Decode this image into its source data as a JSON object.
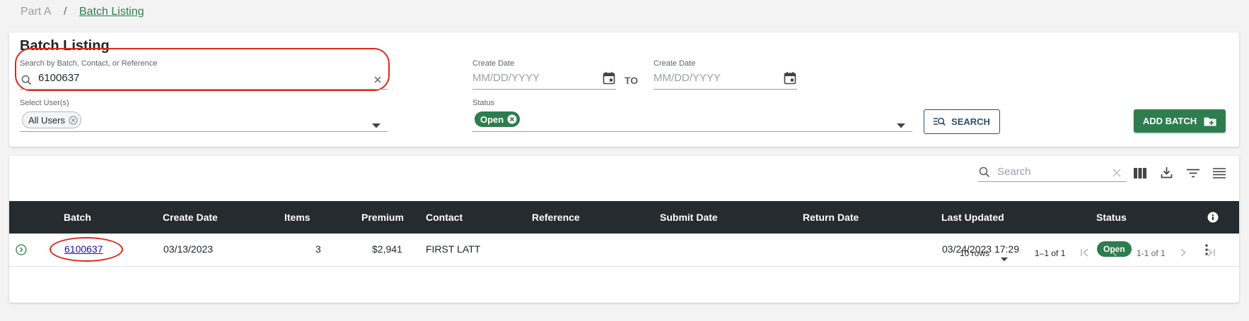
{
  "breadcrumb": {
    "root": "Part A",
    "separator": "/",
    "current": "Batch Listing"
  },
  "filters": {
    "title": "Batch Listing",
    "search": {
      "label": "Search by Batch, Contact, or Reference",
      "value": "6100637"
    },
    "create_date_from": {
      "label": "Create Date",
      "placeholder": "MM/DD/YYYY"
    },
    "to_label": "TO",
    "create_date_to": {
      "label": "Create Date",
      "placeholder": "MM/DD/YYYY"
    },
    "users": {
      "label": "Select User(s)",
      "chip": "All Users"
    },
    "status": {
      "label": "Status",
      "chip": "Open"
    },
    "search_button": "SEARCH",
    "add_batch_button": "ADD BATCH"
  },
  "toolbar": {
    "search_placeholder": "Search"
  },
  "table": {
    "columns": [
      "Batch",
      "Create Date",
      "Items",
      "Premium",
      "Contact",
      "Reference",
      "Submit Date",
      "Return Date",
      "Last Updated",
      "Status"
    ],
    "rows": [
      {
        "batch": "6100637",
        "create_date": "03/13/2023",
        "items": "3",
        "premium": "$2,941",
        "contact": "FIRST LATT",
        "reference": "",
        "submit_date": "",
        "return_date": "",
        "last_updated": "03/24/2023 17:29",
        "status": "Open"
      }
    ]
  },
  "pagination": {
    "rows_per_page": "10 rows",
    "range": "1–1 of 1",
    "page_info": "1-1 of 1"
  },
  "colors": {
    "brand_green": "#2e7d4f",
    "header_dark": "#262b2f",
    "annotation_red": "#e0261c",
    "link_blue": "#1a0dab"
  }
}
